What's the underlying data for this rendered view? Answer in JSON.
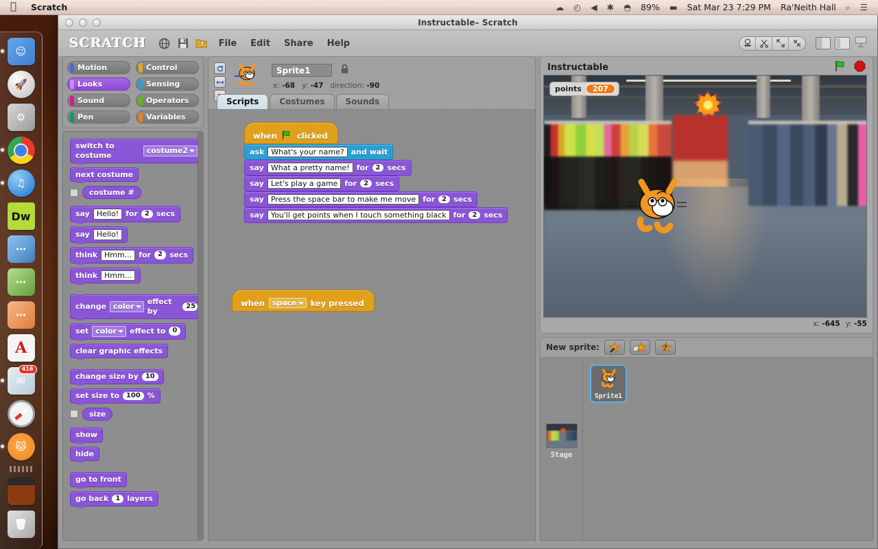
{
  "menubar": {
    "apple_icon": "apple-icon",
    "app_name": "Scratch",
    "right_items": [
      {
        "name": "dropbox-icon",
        "text": "☁"
      },
      {
        "name": "timemachine-icon",
        "text": "◴"
      },
      {
        "name": "volume-icon",
        "text": "◀"
      },
      {
        "name": "bluetooth-icon",
        "text": "✱"
      },
      {
        "name": "wifi-icon",
        "text": "◓"
      },
      {
        "name": "battery-percent",
        "text": "89%"
      },
      {
        "name": "battery-icon",
        "text": "▬"
      },
      {
        "name": "clock",
        "text": "Sat Mar 23  7:29 PM"
      },
      {
        "name": "user-name",
        "text": "Ra'Neith Hall"
      },
      {
        "name": "spotlight-icon",
        "text": "⌕"
      },
      {
        "name": "notification-center-icon",
        "text": "☰"
      }
    ]
  },
  "dock": {
    "items": [
      {
        "name": "dock-item-finder",
        "label": "Finder",
        "running": true
      },
      {
        "name": "dock-item-launchpad",
        "label": "Launchpad",
        "running": false
      },
      {
        "name": "dock-item-system-preferences",
        "label": "System Preferences",
        "running": false
      },
      {
        "name": "dock-item-chrome",
        "label": "Google Chrome",
        "running": true
      },
      {
        "name": "dock-item-itunes",
        "label": "iTunes",
        "running": true
      },
      {
        "name": "dock-item-dreamweaver",
        "label": "Dw",
        "running": false
      },
      {
        "name": "dock-item-word",
        "label": "Word",
        "running": false
      },
      {
        "name": "dock-item-excel",
        "label": "Excel",
        "running": false
      },
      {
        "name": "dock-item-powerpoint",
        "label": "PowerPoint",
        "running": false
      },
      {
        "name": "dock-item-acrobat",
        "label": "Adobe Acrobat",
        "running": false
      },
      {
        "name": "dock-item-mail",
        "label": "Mail",
        "running": true,
        "badge": "416"
      },
      {
        "name": "dock-item-safari",
        "label": "Safari",
        "running": false
      },
      {
        "name": "dock-item-scratch",
        "label": "Scratch",
        "running": true
      },
      {
        "name": "dock-item-downloads",
        "label": "Downloads",
        "running": false
      },
      {
        "name": "dock-item-trash",
        "label": "Trash",
        "running": false
      }
    ]
  },
  "window": {
    "title": "Instructable– Scratch"
  },
  "toolbar": {
    "logo": "SCRATCH",
    "share_globe_icon": "globe-icon",
    "save_icon": "save-icon",
    "open_icon": "open-project-icon",
    "menus": [
      "File",
      "Edit",
      "Share",
      "Help"
    ],
    "edit_tools": [
      {
        "name": "duplicate-tool",
        "icon": "stamp-icon"
      },
      {
        "name": "delete-tool",
        "icon": "scissors-icon"
      },
      {
        "name": "grow-tool",
        "icon": "grow-icon"
      },
      {
        "name": "shrink-tool",
        "icon": "shrink-icon"
      }
    ],
    "view_modes": [
      {
        "name": "small-stage-view",
        "selected": false
      },
      {
        "name": "normal-stage-view",
        "selected": true
      },
      {
        "name": "presentation-mode",
        "selected": false
      }
    ]
  },
  "palette": {
    "categories": [
      {
        "label": "Motion",
        "color": "#4a6cd4",
        "active": false
      },
      {
        "label": "Control",
        "color": "#e1a91a",
        "active": false
      },
      {
        "label": "Looks",
        "color": "#8a55d7",
        "active": true
      },
      {
        "label": "Sensing",
        "color": "#2b9fd6",
        "active": false
      },
      {
        "label": "Sound",
        "color": "#d91a8f",
        "active": false
      },
      {
        "label": "Operators",
        "color": "#5cb712",
        "active": false
      },
      {
        "label": "Pen",
        "color": "#0e9a6c",
        "active": false
      },
      {
        "label": "Variables",
        "color": "#ee7d16",
        "active": false
      }
    ],
    "blocks": [
      {
        "type": "stack",
        "parts": [
          {
            "t": "label",
            "v": "switch to costume"
          },
          {
            "t": "drop",
            "v": "costume2"
          }
        ]
      },
      {
        "type": "stack",
        "parts": [
          {
            "t": "label",
            "v": "next costume"
          }
        ]
      },
      {
        "type": "reporter",
        "checkbox": true,
        "parts": [
          {
            "t": "label",
            "v": "costume #"
          }
        ]
      },
      {
        "type": "gap"
      },
      {
        "type": "stack",
        "parts": [
          {
            "t": "label",
            "v": "say"
          },
          {
            "t": "text",
            "v": "Hello!"
          },
          {
            "t": "label",
            "v": "for"
          },
          {
            "t": "num",
            "v": "2"
          },
          {
            "t": "label",
            "v": "secs"
          }
        ]
      },
      {
        "type": "stack",
        "parts": [
          {
            "t": "label",
            "v": "say"
          },
          {
            "t": "text",
            "v": "Hello!"
          }
        ]
      },
      {
        "type": "stack",
        "parts": [
          {
            "t": "label",
            "v": "think"
          },
          {
            "t": "text",
            "v": "Hmm..."
          },
          {
            "t": "label",
            "v": "for"
          },
          {
            "t": "num",
            "v": "2"
          },
          {
            "t": "label",
            "v": "secs"
          }
        ]
      },
      {
        "type": "stack",
        "parts": [
          {
            "t": "label",
            "v": "think"
          },
          {
            "t": "text",
            "v": "Hmm..."
          }
        ]
      },
      {
        "type": "gap"
      },
      {
        "type": "stack",
        "parts": [
          {
            "t": "label",
            "v": "change"
          },
          {
            "t": "drop",
            "v": "color"
          },
          {
            "t": "label",
            "v": "effect by"
          },
          {
            "t": "num",
            "v": "25"
          }
        ]
      },
      {
        "type": "stack",
        "parts": [
          {
            "t": "label",
            "v": "set"
          },
          {
            "t": "drop",
            "v": "color"
          },
          {
            "t": "label",
            "v": "effect to"
          },
          {
            "t": "num",
            "v": "0"
          }
        ]
      },
      {
        "type": "stack",
        "parts": [
          {
            "t": "label",
            "v": "clear graphic effects"
          }
        ]
      },
      {
        "type": "gap"
      },
      {
        "type": "stack",
        "parts": [
          {
            "t": "label",
            "v": "change size by"
          },
          {
            "t": "num",
            "v": "10"
          }
        ]
      },
      {
        "type": "stack",
        "parts": [
          {
            "t": "label",
            "v": "set size to"
          },
          {
            "t": "num",
            "v": "100"
          },
          {
            "t": "label",
            "v": "%"
          }
        ]
      },
      {
        "type": "reporter",
        "checkbox": true,
        "parts": [
          {
            "t": "label",
            "v": "size"
          }
        ]
      },
      {
        "type": "gap"
      },
      {
        "type": "stack",
        "parts": [
          {
            "t": "label",
            "v": "show"
          }
        ]
      },
      {
        "type": "stack",
        "parts": [
          {
            "t": "label",
            "v": "hide"
          }
        ]
      },
      {
        "type": "gap"
      },
      {
        "type": "stack",
        "parts": [
          {
            "t": "label",
            "v": "go to front"
          }
        ]
      },
      {
        "type": "stack",
        "parts": [
          {
            "t": "label",
            "v": "go back"
          },
          {
            "t": "num",
            "v": "1"
          },
          {
            "t": "label",
            "v": "layers"
          }
        ]
      }
    ]
  },
  "sprite_header": {
    "name": "Sprite1",
    "x_label": "x:",
    "x_value": "-68",
    "y_label": "y:",
    "y_value": "-47",
    "direction_label": "direction:",
    "direction_value": "-90",
    "lock_icon": "lock-icon",
    "rotation_buttons": [
      {
        "name": "rotate-freely-button",
        "icon": "rotate-icon"
      },
      {
        "name": "left-right-flip-button",
        "icon": "flip-icon"
      },
      {
        "name": "no-rotation-button",
        "icon": "no-rotate-icon"
      }
    ],
    "tabs": [
      {
        "label": "Scripts",
        "selected": true
      },
      {
        "label": "Costumes",
        "selected": false
      },
      {
        "label": "Sounds",
        "selected": false
      }
    ]
  },
  "scripts": {
    "stacks": [
      {
        "name": "green-flag-script",
        "hat": {
          "pre": "when",
          "icon": "green-flag-icon",
          "post": "clicked"
        },
        "rows": [
          {
            "cat": "sense",
            "parts": [
              {
                "t": "label",
                "v": "ask"
              },
              {
                "t": "text",
                "v": "What's your name?"
              },
              {
                "t": "label",
                "v": "and wait"
              }
            ]
          },
          {
            "cat": "look",
            "parts": [
              {
                "t": "label",
                "v": "say"
              },
              {
                "t": "text",
                "v": "What a pretty name!"
              },
              {
                "t": "label",
                "v": "for"
              },
              {
                "t": "num",
                "v": "2"
              },
              {
                "t": "label",
                "v": "secs"
              }
            ]
          },
          {
            "cat": "look",
            "parts": [
              {
                "t": "label",
                "v": "say"
              },
              {
                "t": "text",
                "v": "Let's play a game"
              },
              {
                "t": "label",
                "v": "for"
              },
              {
                "t": "num",
                "v": "2"
              },
              {
                "t": "label",
                "v": "secs"
              }
            ]
          },
          {
            "cat": "look",
            "parts": [
              {
                "t": "label",
                "v": "say"
              },
              {
                "t": "text",
                "v": "Press the space bar to make me move"
              },
              {
                "t": "label",
                "v": "for"
              },
              {
                "t": "num",
                "v": "2"
              },
              {
                "t": "label",
                "v": "secs"
              }
            ]
          },
          {
            "cat": "look",
            "parts": [
              {
                "t": "label",
                "v": "say"
              },
              {
                "t": "text",
                "v": "You'll get points when I touch something black"
              },
              {
                "t": "label",
                "v": "for"
              },
              {
                "t": "num",
                "v": "2"
              },
              {
                "t": "label",
                "v": "secs"
              }
            ]
          }
        ]
      },
      {
        "name": "key-pressed-script",
        "hat": {
          "pre": "when",
          "drop": "space",
          "post": "key pressed"
        },
        "rows": []
      }
    ]
  },
  "stage": {
    "title": "Instructable",
    "green_flag_icon": "green-flag-icon",
    "stop_icon": "stop-sign-icon",
    "watcher": {
      "label": "points",
      "value": "207",
      "color": "#ec7c15"
    },
    "mouse_x_label": "x:",
    "mouse_x": "-645",
    "mouse_y_label": "y:",
    "mouse_y": "-55"
  },
  "corral": {
    "new_sprite_label": "New sprite:",
    "buttons": [
      {
        "name": "paint-new-sprite-button",
        "icon": "paintbrush-star-icon"
      },
      {
        "name": "import-sprite-button",
        "icon": "folder-star-icon"
      },
      {
        "name": "surprise-sprite-button",
        "icon": "question-star-icon"
      }
    ],
    "stage_label": "Stage",
    "sprites": [
      {
        "name": "Sprite1",
        "selected": true
      }
    ]
  }
}
